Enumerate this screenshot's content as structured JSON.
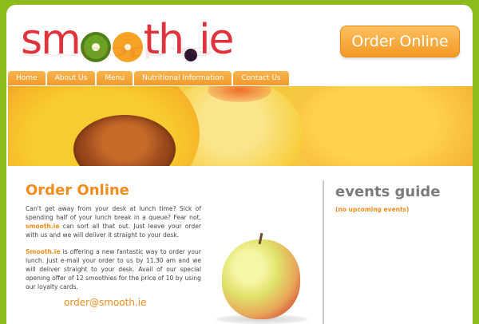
{
  "header": {
    "logo_text": "smooth.ie",
    "order_button_label": "Order Online"
  },
  "nav": {
    "items": [
      {
        "label": "Home"
      },
      {
        "label": "About Us"
      },
      {
        "label": "Menu"
      },
      {
        "label": "Nutritional Information"
      },
      {
        "label": "Contact Us"
      }
    ]
  },
  "main": {
    "title": "Order Online",
    "para1_text": "Can't get away from your desk at lunch time? Sick of spending half of your lunch break in a queue? Fear not, ",
    "para1_brand": "smooth.ie",
    "para1_rest": " can sort all that out. Just leave your order with us and we will deliver it straight to your desk.",
    "para2_brand": "Smooth.ie",
    "para2_rest": " is offering a new fantastic way to order your lunch. Just e-mail your order to us by 11.30 am and we will deliver straight to your desk. Avail of our special opening offer of 12 smoothies for the price of 10 by using our loyalty cards.",
    "email": "order@smooth.ie"
  },
  "events": {
    "title": "events guide",
    "empty_text": "(no upcoming events)"
  },
  "colors": {
    "background": "#8dbb1c",
    "accent": "#f28c1f",
    "logo": "#e0343c"
  }
}
